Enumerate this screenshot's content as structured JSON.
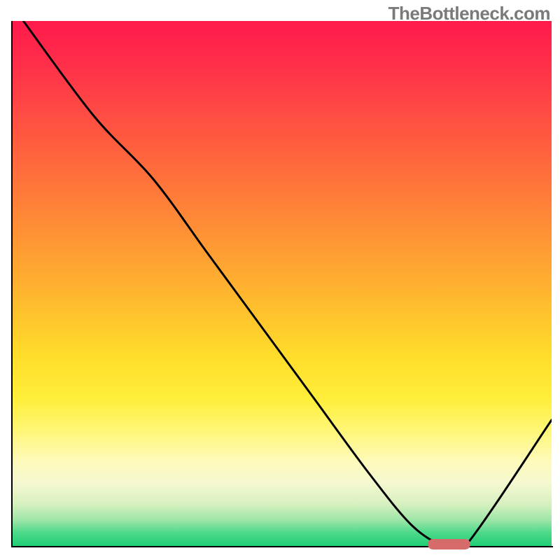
{
  "watermark": "TheBottleneck.com",
  "chart_data": {
    "type": "line",
    "title": "",
    "xlabel": "",
    "ylabel": "",
    "xlim": [
      0,
      100
    ],
    "ylim": [
      0,
      100
    ],
    "x": [
      2,
      15,
      26,
      36,
      46,
      56,
      66,
      74,
      80,
      84,
      100
    ],
    "values": [
      100,
      82,
      70,
      56,
      42,
      28,
      14,
      4,
      0,
      0,
      24
    ],
    "marker": {
      "x_start": 77,
      "x_end": 85,
      "y": 0
    },
    "background_gradient": {
      "top": "#ff1a4b",
      "mid": "#ffde2a",
      "bottom": "#1fcf76"
    }
  },
  "colors": {
    "curve": "#000000",
    "marker": "#d66b6b",
    "watermark": "#7a7a7a"
  }
}
